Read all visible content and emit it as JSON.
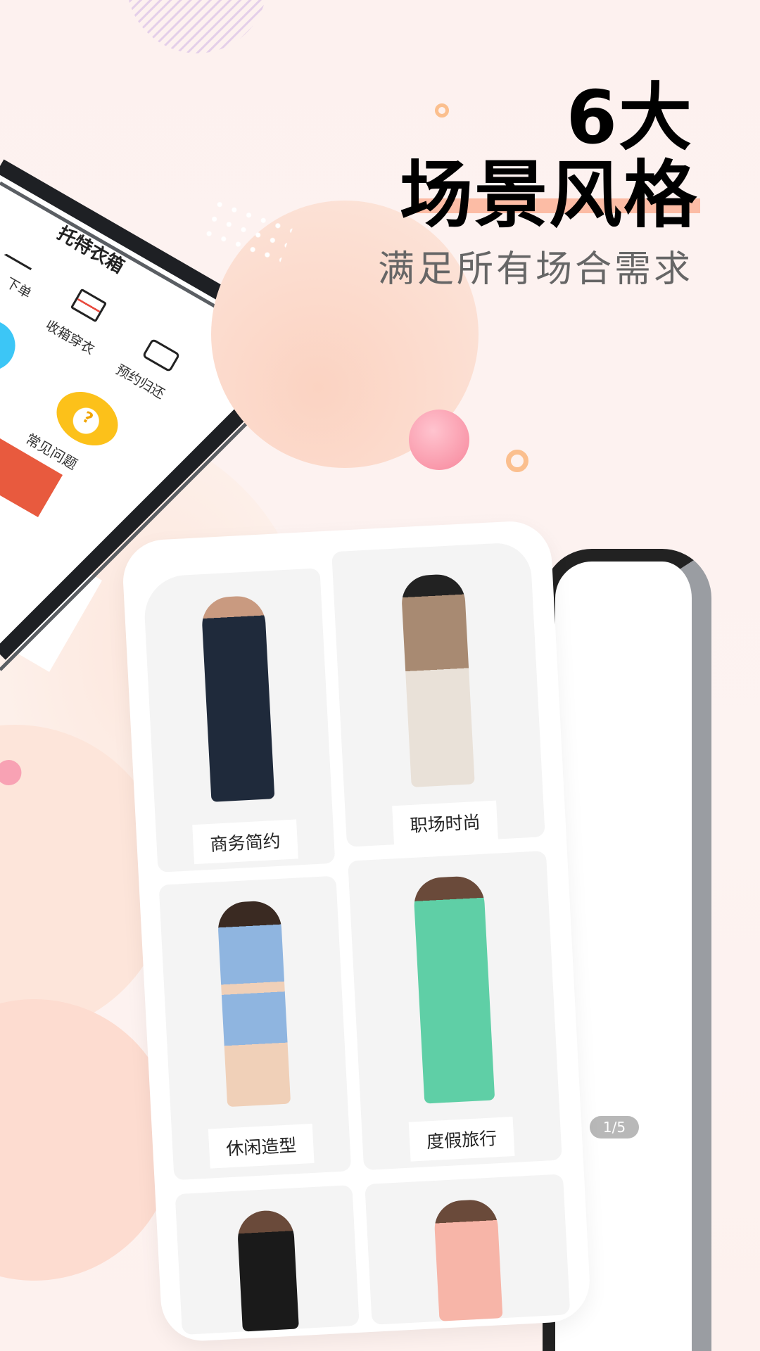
{
  "headline": {
    "line1": "6大",
    "line2": "场景风格",
    "subtitle": "满足所有场合需求",
    "highlight_color": "#fcbca5"
  },
  "left_phone": {
    "title": "托特衣箱",
    "steps": [
      {
        "label": "下单",
        "icon": "hanger-icon"
      },
      {
        "label": "收箱穿衣",
        "icon": "box-icon"
      },
      {
        "label": "预约归还",
        "icon": "truck-icon"
      }
    ],
    "faq": {
      "label": "常见问题",
      "icon": "question-bubble-icon",
      "color": "#fcc11a"
    },
    "accent": "#e85a3e"
  },
  "scenes": [
    {
      "label": "商务简约"
    },
    {
      "label": "职场时尚"
    },
    {
      "label": "休闲造型"
    },
    {
      "label": "度假旅行"
    },
    {
      "label": ""
    },
    {
      "label": ""
    }
  ],
  "right_phone": {
    "page_indicator": "1/5"
  }
}
